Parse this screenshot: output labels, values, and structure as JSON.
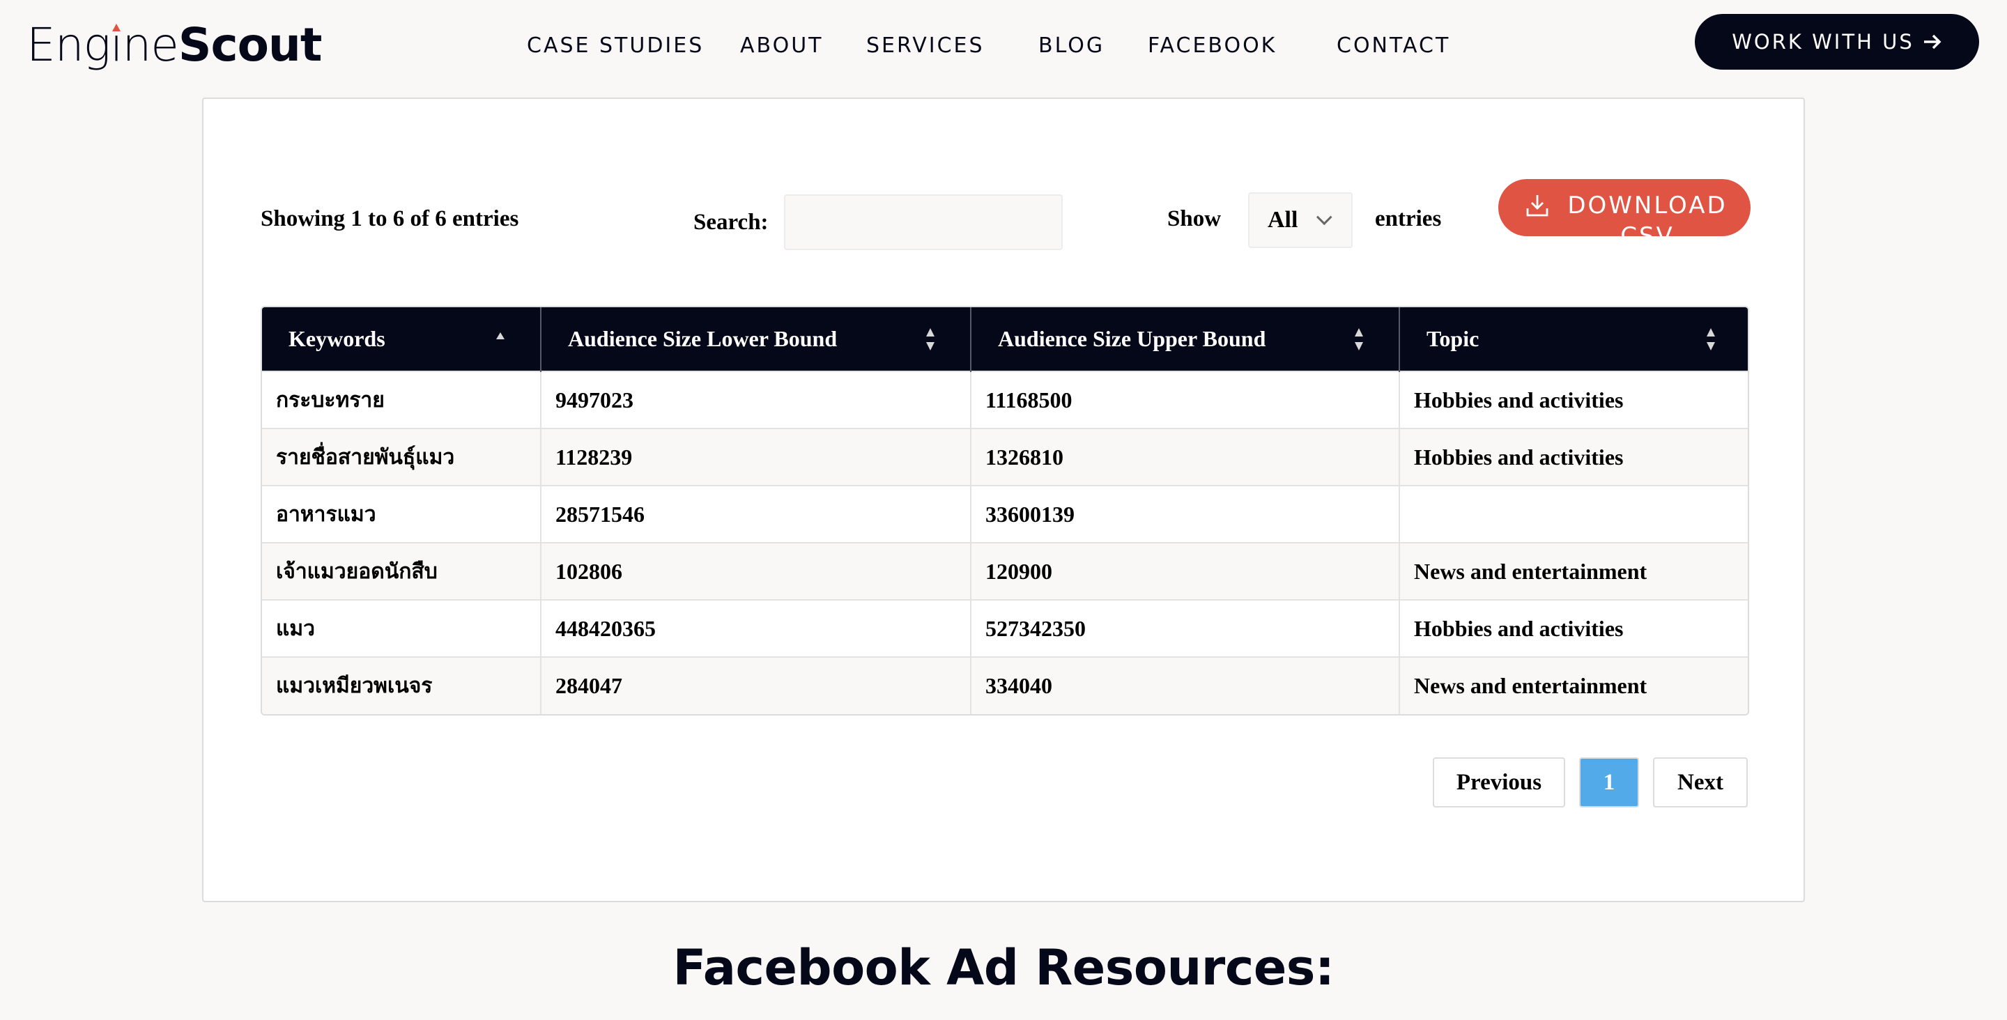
{
  "header": {
    "logo": {
      "part1": "Engine",
      "part2": "Scout"
    },
    "nav": [
      {
        "label": "CASE STUDIES"
      },
      {
        "label": "ABOUT"
      },
      {
        "label": "SERVICES"
      },
      {
        "label": "BLOG"
      },
      {
        "label": "FACEBOOK"
      },
      {
        "label": "CONTACT"
      }
    ],
    "cta_label": "WORK WITH US",
    "cta_icon": "arrow-right-icon"
  },
  "controls": {
    "info": "Showing 1 to 6 of 6 entries",
    "search_label": "Search:",
    "search_value": "",
    "show_label": "Show",
    "page_length_selected": "All",
    "entries_label": "entries",
    "download_label": "DOWNLOAD CSV",
    "download_icon": "download-icon"
  },
  "table": {
    "columns": [
      {
        "label": "Keywords",
        "sort": "asc"
      },
      {
        "label": "Audience Size Lower Bound",
        "sort": "both"
      },
      {
        "label": "Audience Size Upper Bound",
        "sort": "both"
      },
      {
        "label": "Topic",
        "sort": "both"
      }
    ],
    "rows": [
      {
        "keyword": "กระบะทราย",
        "lower": "9497023",
        "upper": "11168500",
        "topic": "Hobbies and activities"
      },
      {
        "keyword": "รายชื่อสายพันธุ์แมว",
        "lower": "1128239",
        "upper": "1326810",
        "topic": "Hobbies and activities"
      },
      {
        "keyword": "อาหารแมว",
        "lower": "28571546",
        "upper": "33600139",
        "topic": ""
      },
      {
        "keyword": "เจ้าแมวยอดนักสืบ",
        "lower": "102806",
        "upper": "120900",
        "topic": "News and entertainment"
      },
      {
        "keyword": "แมว",
        "lower": "448420365",
        "upper": "527342350",
        "topic": "Hobbies and activities"
      },
      {
        "keyword": "แมวเหมียวพเนจร",
        "lower": "284047",
        "upper": "334040",
        "topic": "News and entertainment"
      }
    ]
  },
  "pagination": {
    "previous": "Previous",
    "current_page": "1",
    "next": "Next"
  },
  "section_heading": "Facebook Ad Resources:",
  "colors": {
    "brand_dark": "#050818",
    "accent_red": "#e05443",
    "page_active_blue": "#52aae8",
    "background": "#f9f8f6"
  }
}
